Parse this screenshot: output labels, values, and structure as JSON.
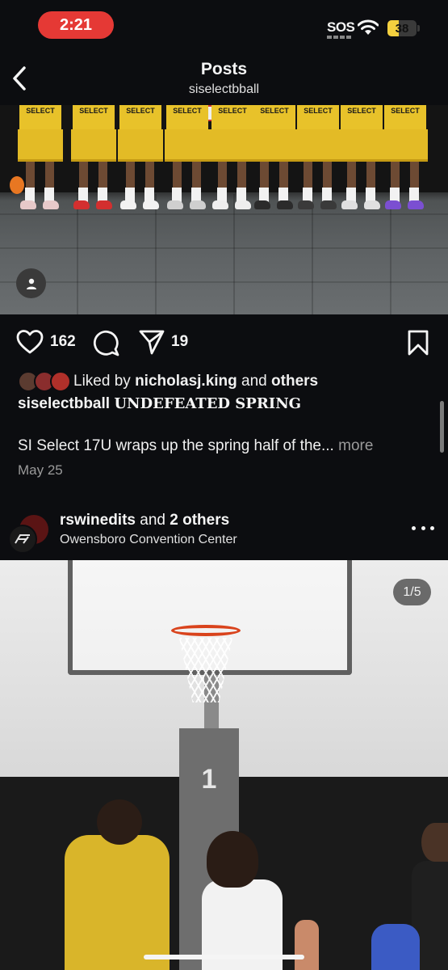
{
  "status_bar": {
    "time": "2:21",
    "sos": "SOS",
    "battery": "38",
    "battery_level": 0.38,
    "battery_color": "#f4d03f",
    "time_pill_color": "#e53935"
  },
  "header": {
    "title": "Posts",
    "subtitle": "siselectbball",
    "back_icon": "chevron-left-icon"
  },
  "post1": {
    "image": {
      "jersey_text": "SELECT",
      "tag_icon": "person-icon"
    },
    "actions": {
      "like_count": "162",
      "share_count": "19",
      "icons": [
        "heart-icon",
        "comment-icon",
        "send-icon",
        "bookmark-icon"
      ]
    },
    "liked_by": {
      "prefix": "Liked by",
      "user": "nicholasj.king",
      "middle": "and",
      "suffix": "others"
    },
    "caption": {
      "user": "siselectbball",
      "title": "UNDEFEATED SPRING",
      "text": "SI Select 17U wraps up the spring half of the...",
      "more": "more"
    },
    "date": "May 25"
  },
  "post2": {
    "user": "rswinedits",
    "with_text": "and",
    "others": "2 others",
    "location": "Owensboro Convention Center",
    "image": {
      "counter": "1/5",
      "pole_number": "1"
    }
  },
  "colors": {
    "background": "#0c0d10",
    "jersey": "#e8c22a"
  }
}
